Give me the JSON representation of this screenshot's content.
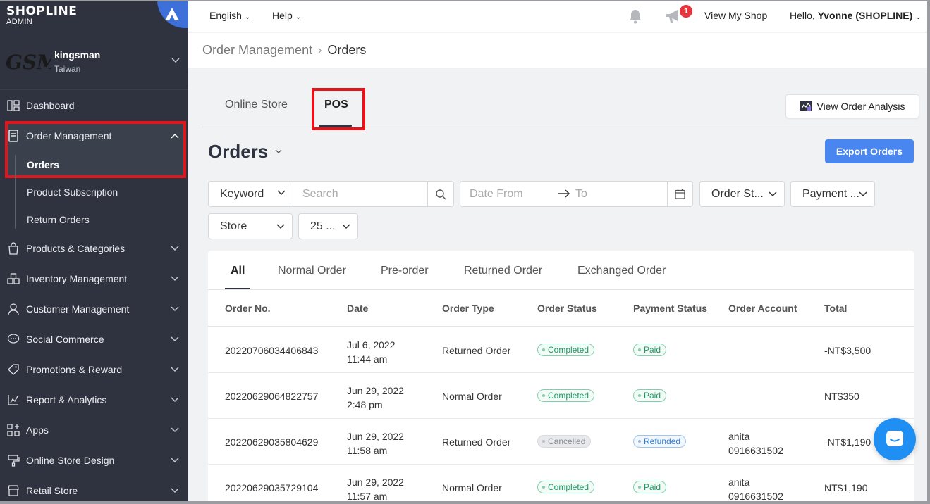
{
  "brand": {
    "name": "SHOPLINE",
    "sub": "ADMIN"
  },
  "account": {
    "logo_text": "GSM",
    "name": "kingsman",
    "region": "Taiwan"
  },
  "sidebar": {
    "items": [
      {
        "label": "Dashboard",
        "icon": "dashboard-icon"
      },
      {
        "label": "Order Management",
        "icon": "document-icon",
        "expanded": true
      },
      {
        "label": "Products & Categories",
        "icon": "bag-icon"
      },
      {
        "label": "Inventory Management",
        "icon": "inventory-icon"
      },
      {
        "label": "Customer Management",
        "icon": "user-icon"
      },
      {
        "label": "Social Commerce",
        "icon": "chat-bubble-icon"
      },
      {
        "label": "Promotions & Reward",
        "icon": "tag-icon"
      },
      {
        "label": "Report & Analytics",
        "icon": "chart-icon"
      },
      {
        "label": "Apps",
        "icon": "apps-icon"
      },
      {
        "label": "Online Store Design",
        "icon": "paint-icon"
      },
      {
        "label": "Retail Store",
        "icon": "store-icon"
      }
    ],
    "subitems": [
      {
        "label": "Orders",
        "active": true
      },
      {
        "label": "Product Subscription"
      },
      {
        "label": "Return Orders"
      }
    ]
  },
  "topbar": {
    "language": "English",
    "help": "Help",
    "notification_count": "1",
    "view_shop": "View My Shop",
    "hello_prefix": "Hello, ",
    "hello_user": "Yvonne (SHOPLINE)"
  },
  "breadcrumb": {
    "parent": "Order Management",
    "current": "Orders"
  },
  "channel_tabs": {
    "online": "Online Store",
    "pos": "POS"
  },
  "view_analysis_label": "View Order Analysis",
  "page_title": "Orders",
  "export_label": "Export Orders",
  "filters": {
    "keyword": "Keyword",
    "search_placeholder": "Search",
    "date_from": "Date From",
    "date_to": "To",
    "order_status": "Order St...",
    "payment": "Payment ...",
    "store": "Store",
    "per_page": "25 ..."
  },
  "status_tabs": [
    "All",
    "Normal Order",
    "Pre-order",
    "Returned Order",
    "Exchanged Order"
  ],
  "columns": [
    "Order No.",
    "Date",
    "Order Type",
    "Order Status",
    "Payment Status",
    "Order Account",
    "Total"
  ],
  "rows": [
    {
      "order_no": "20220706034406843",
      "date": "Jul 6, 2022",
      "time": "11:44 am",
      "type": "Returned Order",
      "status": "Completed",
      "status_kind": "green",
      "payment": "Paid",
      "payment_kind": "green",
      "account_name": "",
      "account_phone": "",
      "total": "-NT$3,500"
    },
    {
      "order_no": "20220629064822757",
      "date": "Jun 29, 2022",
      "time": "2:48 pm",
      "type": "Normal Order",
      "status": "Completed",
      "status_kind": "green",
      "payment": "Paid",
      "payment_kind": "green",
      "account_name": "",
      "account_phone": "",
      "total": "NT$350"
    },
    {
      "order_no": "20220629035804629",
      "date": "Jun 29, 2022",
      "time": "11:58 am",
      "type": "Returned Order",
      "status": "Cancelled",
      "status_kind": "grey",
      "payment": "Refunded",
      "payment_kind": "blue",
      "account_name": "anita",
      "account_phone": "0916631502",
      "total": "-NT$1,190"
    },
    {
      "order_no": "20220629035729104",
      "date": "Jun 29, 2022",
      "time": "11:57 am",
      "type": "Normal Order",
      "status": "Completed",
      "status_kind": "green",
      "payment": "Paid",
      "payment_kind": "green",
      "account_name": "anita",
      "account_phone": "0916631502",
      "total": "NT$1,190"
    }
  ],
  "colors": {
    "sidebar": "#2f3340",
    "accent": "#4a86f0",
    "highlight": "#e3141b"
  }
}
